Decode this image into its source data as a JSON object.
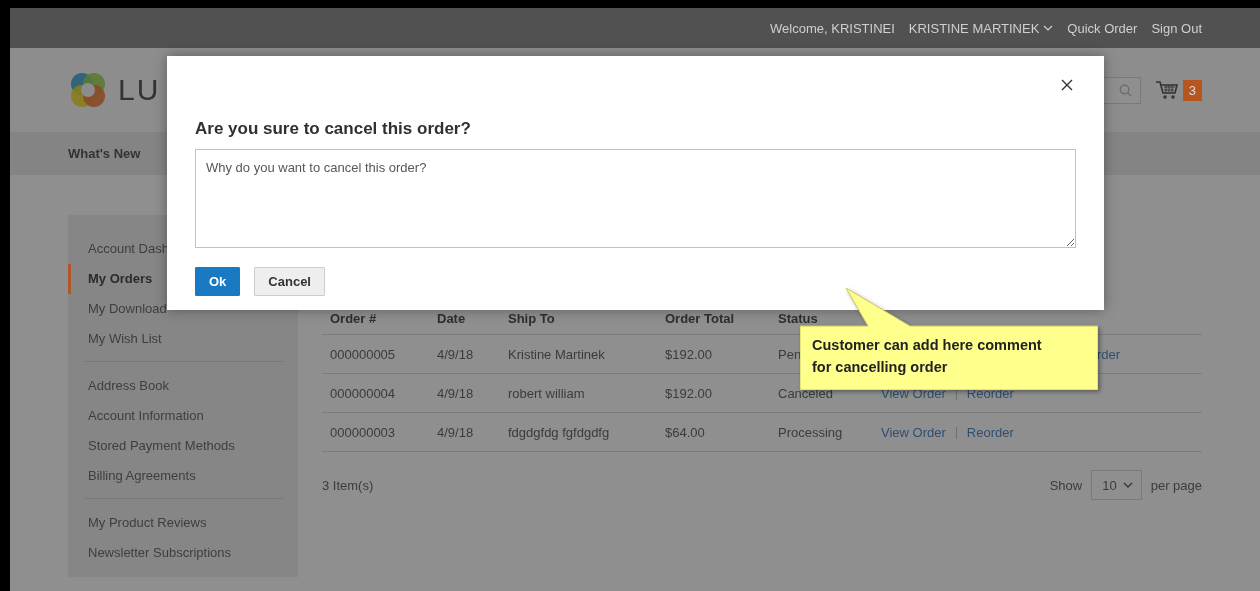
{
  "header_links": [
    {
      "label": "Welcome, KRISTINEI",
      "kind": "text"
    },
    {
      "label": "KRISTINE MARTINEK",
      "kind": "menu"
    },
    {
      "label": "Quick Order",
      "kind": "link"
    },
    {
      "label": "Sign Out",
      "kind": "link"
    }
  ],
  "logo": {
    "text": "LU"
  },
  "cart": {
    "count": "3"
  },
  "nav": [
    {
      "label": "What's New"
    }
  ],
  "sidebar": {
    "groups": [
      [
        {
          "label": "Account Dash",
          "selected": false
        },
        {
          "label": "My Orders",
          "selected": true
        },
        {
          "label": "My Download",
          "selected": false
        },
        {
          "label": "My Wish List",
          "selected": false
        }
      ],
      [
        {
          "label": "Address Book",
          "selected": false
        },
        {
          "label": "Account Information",
          "selected": false
        },
        {
          "label": "Stored Payment Methods",
          "selected": false
        },
        {
          "label": "Billing Agreements",
          "selected": false
        }
      ],
      [
        {
          "label": "My Product Reviews",
          "selected": false
        },
        {
          "label": "Newsletter Subscriptions",
          "selected": false
        }
      ]
    ]
  },
  "orders": {
    "columns": [
      "Order #",
      "Date",
      "Ship To",
      "Order Total",
      "Status"
    ],
    "rows": [
      {
        "cells": [
          "000000005",
          "4/9/18",
          "Kristine Martinek",
          "$192.00",
          "Pen"
        ],
        "actions": [
          {
            "label": "rder",
            "kind": "cut"
          }
        ]
      },
      {
        "cells": [
          "000000004",
          "4/9/18",
          "robert william",
          "$192.00",
          "Canceled"
        ],
        "actions": [
          {
            "label": "View Order",
            "kind": "link"
          },
          {
            "label": "Reorder",
            "kind": "link"
          }
        ]
      },
      {
        "cells": [
          "000000003",
          "4/9/18",
          "fdgdgfdg fgfdgdfg",
          "$64.00",
          "Processing"
        ],
        "actions": [
          {
            "label": "View Order",
            "kind": "link"
          },
          {
            "label": "Reorder",
            "kind": "link"
          }
        ]
      }
    ],
    "count": "3 Item(s)",
    "pager": {
      "show": "Show",
      "value": "10",
      "suffix": "per page"
    }
  },
  "modal": {
    "title": "Are you sure to cancel this order?",
    "placeholder": "Why do you want to cancel this order?",
    "buttons": [
      {
        "label": "Ok",
        "kind": "primary"
      },
      {
        "label": "Cancel",
        "kind": "secondary"
      }
    ]
  },
  "callout": {
    "text": "Customer can add here comment for cancelling order"
  }
}
